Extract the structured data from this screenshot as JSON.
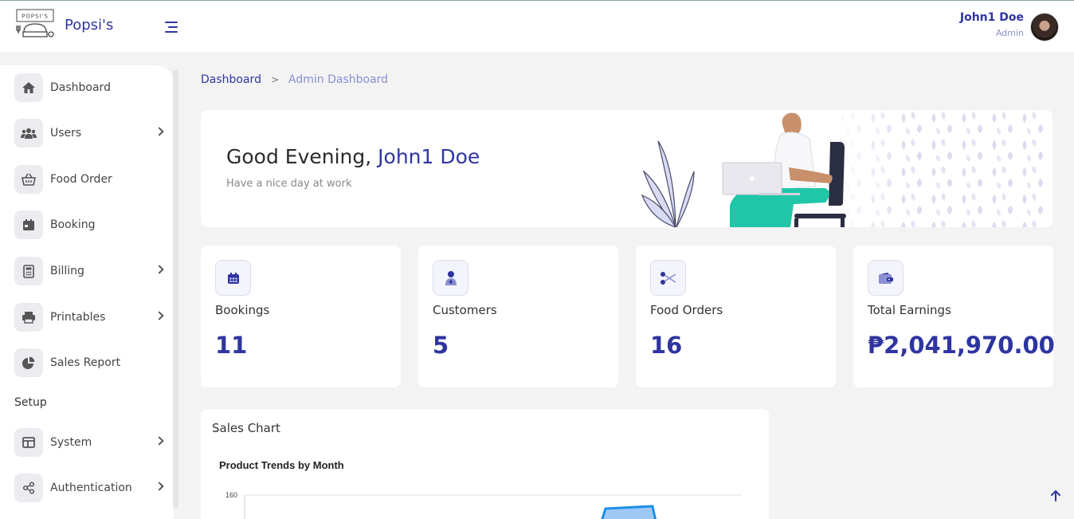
{
  "app": {
    "brand": "Popsi's",
    "logo_text": "POPSI'S"
  },
  "user": {
    "name": "John1 Doe",
    "role": "Admin"
  },
  "sidebar": {
    "items": [
      {
        "label": "Dashboard",
        "icon": "home-icon",
        "has_submenu": false
      },
      {
        "label": "Users",
        "icon": "users-icon",
        "has_submenu": true
      },
      {
        "label": "Food Order",
        "icon": "basket-icon",
        "has_submenu": false
      },
      {
        "label": "Booking",
        "icon": "calendar-icon",
        "has_submenu": false
      },
      {
        "label": "Billing",
        "icon": "calculator-icon",
        "has_submenu": true
      },
      {
        "label": "Printables",
        "icon": "printer-icon",
        "has_submenu": true
      },
      {
        "label": "Sales Report",
        "icon": "pie-chart-icon",
        "has_submenu": false
      }
    ],
    "section_label": "Setup",
    "setup_items": [
      {
        "label": "System",
        "icon": "layout-icon",
        "has_submenu": true
      },
      {
        "label": "Authentication",
        "icon": "share-icon",
        "has_submenu": true
      }
    ]
  },
  "breadcrumb": {
    "home": "Dashboard",
    "separator": ">",
    "current": "Admin Dashboard"
  },
  "welcome": {
    "greeting": "Good Evening,",
    "name": "John1 Doe",
    "subtitle": "Have a nice day at work"
  },
  "stats": [
    {
      "title": "Bookings",
      "value": "11",
      "icon": "calendar-icon"
    },
    {
      "title": "Customers",
      "value": "5",
      "icon": "user-add-icon"
    },
    {
      "title": "Food Orders",
      "value": "16",
      "icon": "scissors-icon"
    },
    {
      "title": "Total Earnings",
      "value": "₱2,041,970.00",
      "icon": "wallet-icon"
    }
  ],
  "sales_chart": {
    "card_title": "Sales Chart"
  },
  "chart_data": {
    "type": "area",
    "title": "Product Trends by Month",
    "y_tick_labels": [
      "160"
    ],
    "ylim_top": 160,
    "grid": true
  },
  "colors": {
    "accent": "#2e35a0",
    "accent_light": "#8a8fd0",
    "hero_green": "#1fc6a8",
    "chart_fill": "#9ec9f5",
    "chart_stroke": "#1f8fe8"
  }
}
